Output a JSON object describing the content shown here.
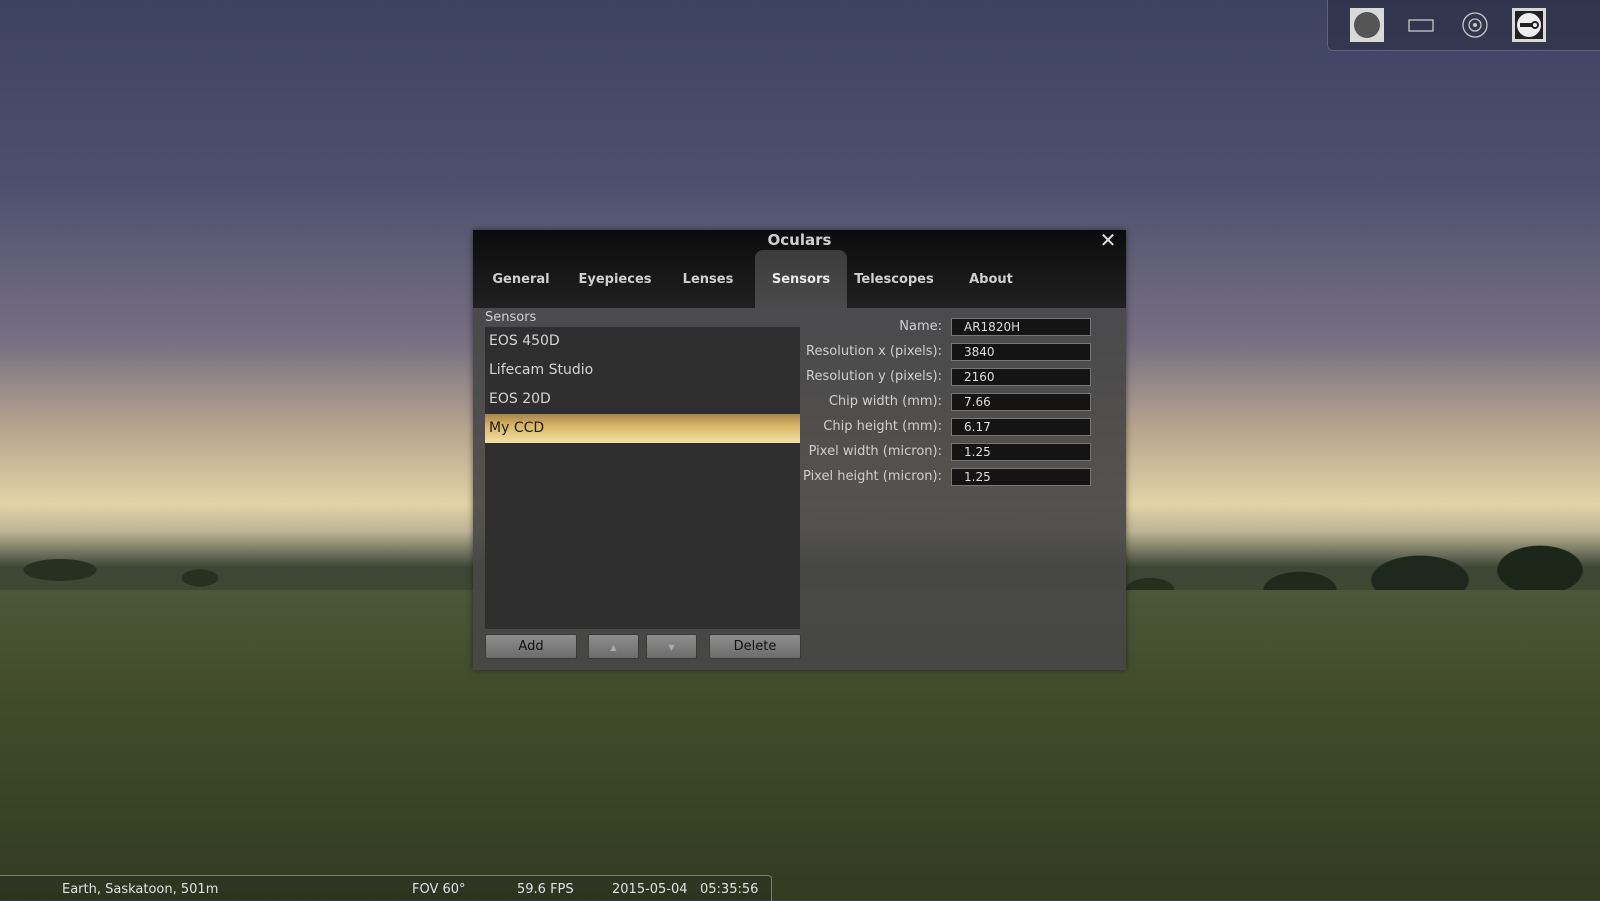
{
  "toolbar": {
    "buttons": [
      {
        "icon": "ocular-circle-icon",
        "active": true
      },
      {
        "icon": "sensor-frame-icon",
        "active": false
      },
      {
        "icon": "telrad-target-icon",
        "active": false
      },
      {
        "icon": "ocular-config-icon",
        "active": true
      }
    ]
  },
  "dialog": {
    "title": "Oculars",
    "close_glyph": "✕",
    "tabs": [
      {
        "label": "General",
        "active": false
      },
      {
        "label": "Eyepieces",
        "active": false
      },
      {
        "label": "Lenses",
        "active": false
      },
      {
        "label": "Sensors",
        "active": true
      },
      {
        "label": "Telescopes",
        "active": false
      },
      {
        "label": "About",
        "active": false
      }
    ],
    "list_label": "Sensors",
    "sensors": [
      "EOS 450D",
      "Lifecam Studio",
      "EOS 20D",
      "My CCD"
    ],
    "selected_sensor": "My CCD",
    "buttons": {
      "add": "Add",
      "move_up": "▲",
      "move_down": "▼",
      "delete": "Delete"
    },
    "fields": [
      {
        "label": "Name:",
        "value": "AR1820H"
      },
      {
        "label": "Resolution x (pixels):",
        "value": "3840"
      },
      {
        "label": "Resolution y (pixels):",
        "value": "2160"
      },
      {
        "label": "Chip width (mm):",
        "value": "7.66"
      },
      {
        "label": "Chip height (mm):",
        "value": "6.17"
      },
      {
        "label": "Pixel width (micron):",
        "value": "1.25"
      },
      {
        "label": "Pixel height (micron):",
        "value": "1.25"
      }
    ]
  },
  "status": {
    "location": "Earth, Saskatoon, 501m",
    "fov": "FOV 60°",
    "fps": "59.6 FPS",
    "date": "2015-05-04",
    "time": "05:35:56"
  },
  "colors": {
    "selected_item": "#d9b664",
    "dialog_bg": "#484848"
  }
}
